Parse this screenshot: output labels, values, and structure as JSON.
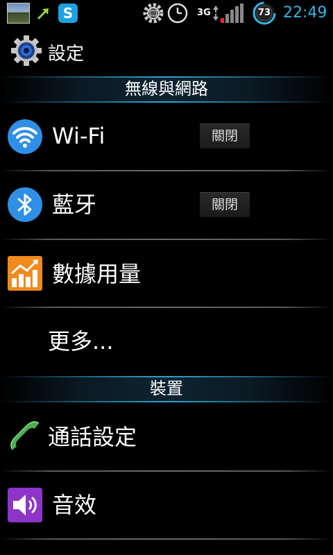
{
  "status_bar": {
    "icons": [
      "photo-thumbnail-icon",
      "sync-icon",
      "skype-icon",
      "settings-gear-icon",
      "clock-icon",
      "network-3g-icon",
      "signal-icon",
      "battery-icon"
    ],
    "network_type": "3G",
    "battery_level": "73",
    "time": "22:49",
    "accent_color": "#33b5e5"
  },
  "title_bar": {
    "title": "設定",
    "icon": "settings-icon"
  },
  "sections": [
    {
      "header": "無線與網路",
      "items": [
        {
          "label": "Wi-Fi",
          "icon": "wifi-icon",
          "toggle": "關閉"
        },
        {
          "label": "藍牙",
          "icon": "bluetooth-icon",
          "toggle": "關閉"
        },
        {
          "label": "數據用量",
          "icon": "data-usage-icon"
        },
        {
          "label": "更多..."
        }
      ]
    },
    {
      "header": "裝置",
      "items": [
        {
          "label": "通話設定",
          "icon": "phone-icon"
        },
        {
          "label": "音效",
          "icon": "sound-icon"
        }
      ]
    }
  ]
}
